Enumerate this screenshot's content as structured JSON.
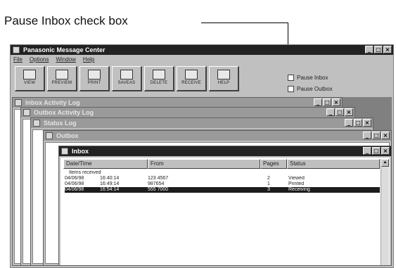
{
  "callout": {
    "text": "Pause Inbox check box"
  },
  "app": {
    "title": "Panasonic Message Center",
    "menu": [
      "File",
      "Options",
      "Window",
      "Help"
    ],
    "toolbar": [
      {
        "label": "VIEW",
        "icon": "view-icon"
      },
      {
        "label": "PREVIEW",
        "icon": "preview-icon"
      },
      {
        "label": "PRINT",
        "icon": "printer-icon"
      },
      {
        "label": "SAVEAS",
        "icon": "save-as-icon"
      },
      {
        "label": "DELETE",
        "icon": "delete-icon"
      },
      {
        "label": "RECEIVE",
        "icon": "receive-icon"
      },
      {
        "label": "HELP",
        "icon": "help-icon"
      }
    ],
    "checkboxes": {
      "pause_inbox": {
        "label": "Pause Inbox",
        "checked": false
      },
      "pause_outbox": {
        "label": "Pause Outbox",
        "checked": false
      }
    }
  },
  "windows": {
    "inbox_activity_log": {
      "title": "Inbox Activity Log"
    },
    "outbox_activity_log": {
      "title": "Outbox Activity Log"
    },
    "status_log": {
      "title": "Status Log"
    },
    "outbox": {
      "title": "Outbox"
    },
    "inbox": {
      "title": "Inbox",
      "columns": [
        "Date/Time",
        "From",
        "Pages",
        "Status"
      ],
      "group_label": "Items received",
      "rows": [
        {
          "date": "04/06/98",
          "time": "16:40:14",
          "from": "123 4567",
          "pages": "2",
          "status": "Viewed",
          "selected": false
        },
        {
          "date": "04/06/98",
          "time": "16:49:14",
          "from": "987654",
          "pages": "1",
          "status": "Printed",
          "selected": false
        },
        {
          "date": "04/06/98",
          "time": "16:54:14",
          "from": "555 7000",
          "pages": "3",
          "status": "Receiving",
          "selected": true
        }
      ]
    }
  },
  "colors": {
    "active_title": "#222222",
    "inactive_title": "#9a9a9a",
    "window_face": "#c0c0c0",
    "mdi_background": "#808080"
  }
}
